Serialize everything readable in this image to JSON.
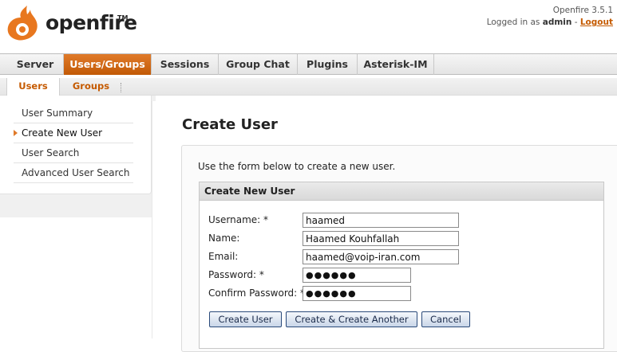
{
  "header": {
    "logo_text": "openfire",
    "logo_tm": "TM",
    "version": "Openfire 3.5.1",
    "logged_in_prefix": "Logged in as",
    "username": "admin",
    "separator": "-",
    "logout_label": "Logout"
  },
  "main_nav": {
    "tabs": [
      {
        "label": "Server",
        "active": false
      },
      {
        "label": "Users/Groups",
        "active": true
      },
      {
        "label": "Sessions",
        "active": false
      },
      {
        "label": "Group Chat",
        "active": false
      },
      {
        "label": "Plugins",
        "active": false
      },
      {
        "label": "Asterisk-IM",
        "active": false
      }
    ]
  },
  "sub_nav": {
    "tabs": [
      {
        "label": "Users",
        "active": true
      },
      {
        "label": "Groups",
        "active": false
      }
    ]
  },
  "sidebar": {
    "items": [
      {
        "label": "User Summary",
        "active": false
      },
      {
        "label": "Create New User",
        "active": true
      },
      {
        "label": "User Search",
        "active": false
      },
      {
        "label": "Advanced User Search",
        "active": false
      }
    ]
  },
  "page": {
    "title": "Create User",
    "intro": "Use the form below to create a new user."
  },
  "form": {
    "panel_title": "Create New User",
    "fields": {
      "username": {
        "label": "Username: *",
        "value": "haamed"
      },
      "name": {
        "label": "Name:",
        "value": "Haamed Kouhfallah"
      },
      "email": {
        "label": "Email:",
        "value": "haamed@voip-iran.com"
      },
      "password": {
        "label": "Password: *",
        "value": "●●●●●●"
      },
      "confirm": {
        "label": "Confirm Password: *",
        "value": "●●●●●●"
      }
    },
    "buttons": {
      "create": "Create User",
      "create_another": "Create & Create Another",
      "cancel": "Cancel"
    }
  },
  "colors": {
    "brand_orange": "#c55a00",
    "active_tab": "#d06a14",
    "button_border": "#2a4a7a"
  },
  "icons": {
    "logo": "openfire-flame-logo",
    "sidebar_active": "orange-triangle-arrow-icon"
  }
}
